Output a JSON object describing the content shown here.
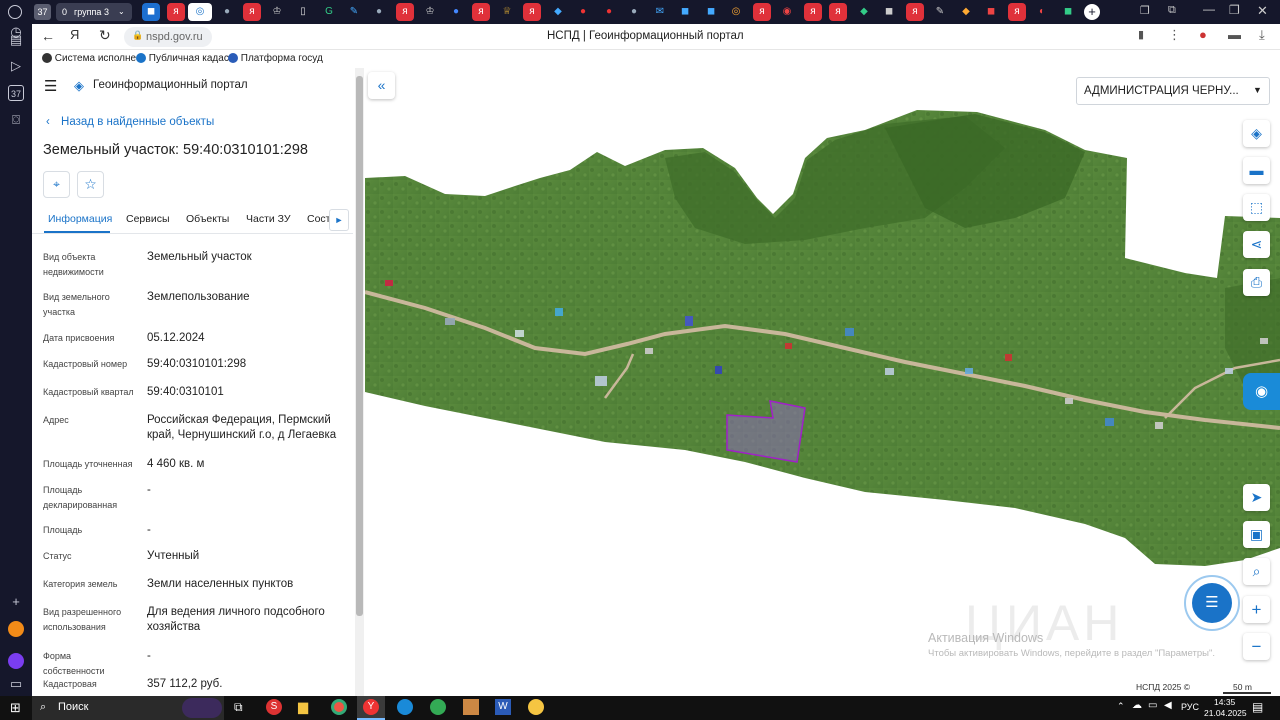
{
  "browser": {
    "tab_counter": "37",
    "group_count": "0",
    "group_label": "группа 3",
    "url": "nspd.gov.ru",
    "page_title": "НСПД | Геоинформационный портал"
  },
  "bookmarks": [
    {
      "label": "Система исполне"
    },
    {
      "label": "Публичная кадас"
    },
    {
      "label": "Платформа госуд"
    }
  ],
  "panel": {
    "app_title": "Геоинформационный портал",
    "back_link": "Назад в найденные объекты",
    "heading": "Земельный участок: 59:40:0310101:298",
    "tabs": [
      "Информация",
      "Сервисы",
      "Объекты",
      "Части ЗУ",
      "Соста"
    ],
    "fields": [
      {
        "label": "Вид объекта недвижимости",
        "value": "Земельный участок"
      },
      {
        "label": "Вид земельного участка",
        "value": "Землепользование"
      },
      {
        "label": "Дата присвоения",
        "value": "05.12.2024"
      },
      {
        "label": "Кадастровый номер",
        "value": "59:40:0310101:298"
      },
      {
        "label": "Кадастровый квартал",
        "value": "59:40:0310101"
      },
      {
        "label": "Адрес",
        "value": "Российская Федерация, Пермский край, Чернушинский г.о, д Легаевка"
      },
      {
        "label": "Площадь уточненная",
        "value": "4 460 кв. м"
      },
      {
        "label": "Площадь декларированная",
        "value": "-"
      },
      {
        "label": "Площадь",
        "value": "-"
      },
      {
        "label": "Статус",
        "value": "Учтенный"
      },
      {
        "label": "Категория земель",
        "value": "Земли населенных пунктов"
      },
      {
        "label": "Вид разрешенного использования",
        "value": "Для ведения личного подсобного хозяйства"
      },
      {
        "label": "Форма собственности",
        "value": "-"
      },
      {
        "label": "Кадастровая",
        "value": "357 112,2 руб."
      }
    ]
  },
  "map": {
    "region_select": "АДМИНИСТРАЦИЯ ЧЕРНУ...",
    "watermark_title": "Активация Windows",
    "watermark_sub": "Чтобы активировать Windows, перейдите в раздел \"Параметры\".",
    "copyright": "НСПД 2025 ©",
    "scale": "50 m",
    "logo_text": "ЦИАН"
  },
  "taskbar": {
    "search": "Поиск",
    "lang": "РУС",
    "time": "14:35",
    "date": "21.04.2025"
  },
  "colors": {
    "accent": "#1a73c8",
    "parcel": "#a020c8",
    "map_green": "#4f7d3a"
  }
}
